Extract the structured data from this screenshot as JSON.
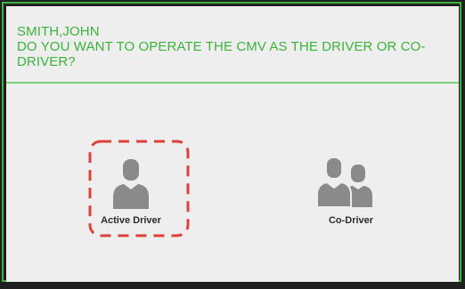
{
  "dialog": {
    "driver_name": "SMITH,JOHN",
    "question_line1": "DO YOU WANT TO OPERATE THE CMV AS THE DRIVER OR CO-",
    "question_line2": "DRIVER?"
  },
  "options": [
    {
      "label": "Active Driver",
      "icon": "single-person-icon"
    },
    {
      "label": "Co-Driver",
      "icon": "two-persons-icon"
    }
  ],
  "colors": {
    "accent_green": "#3bb33b",
    "highlight_red": "#e0403a",
    "icon_gray": "#8a8a8a",
    "dialog_background": "#eeeeee"
  }
}
